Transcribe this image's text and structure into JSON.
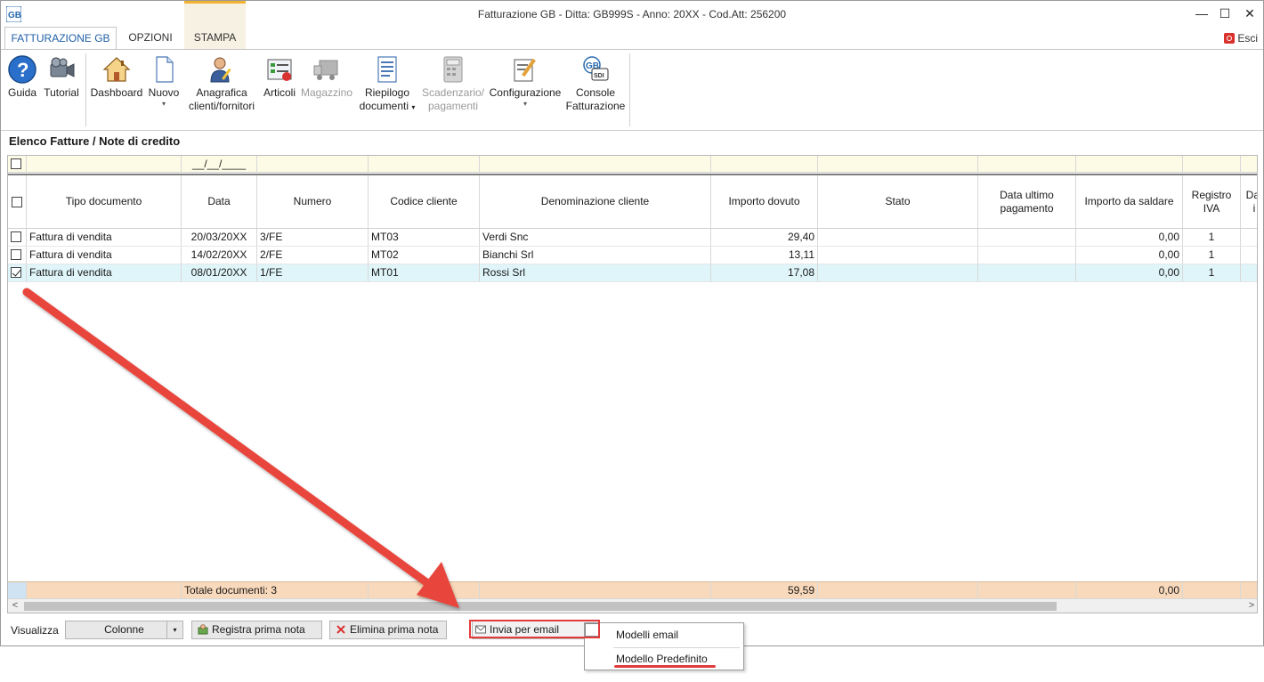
{
  "window": {
    "title": "Fatturazione GB - Ditta: GB999S - Anno: 20XX - Cod.Att: 256200",
    "min_glyph": "—",
    "max_glyph": "☐",
    "close_glyph": "✕",
    "exit_label": "Esci"
  },
  "tabs": [
    {
      "label": "FATTURAZIONE GB"
    },
    {
      "label": "OPZIONI"
    },
    {
      "label": "STAMPA"
    }
  ],
  "ribbon": {
    "guida": "Guida",
    "tutorial": "Tutorial",
    "dashboard": "Dashboard",
    "nuovo": "Nuovo",
    "anagrafica_1": "Anagrafica",
    "anagrafica_2": "clienti/fornitori",
    "articoli": "Articoli",
    "magazzino": "Magazzino",
    "riepilogo_1": "Riepilogo",
    "riepilogo_2": "documenti",
    "scadenzario_1": "Scadenzario/",
    "scadenzario_2": "pagamenti",
    "configurazione": "Configurazione",
    "console_1": "Console",
    "console_2": "Fatturazione",
    "caret": "▾"
  },
  "section_title": "Elenco Fatture / Note di credito",
  "grid": {
    "filter_date_mask": "__/__/____",
    "columns": [
      "Tipo documento",
      "Data",
      "Numero",
      "Codice cliente",
      "Denominazione cliente",
      "Importo dovuto",
      "Stato",
      "Data ultimo pagamento",
      "Importo da saldare",
      "Registro IVA",
      "Dat i"
    ],
    "rows": [
      {
        "checked": false,
        "tipo": "Fattura di vendita",
        "data": "20/03/20XX",
        "numero": "3/FE",
        "codice": "MT03",
        "denominazione": "Verdi Snc",
        "importo": "29,40",
        "stato": "",
        "data_pag": "",
        "saldare": "0,00",
        "registro": "1"
      },
      {
        "checked": false,
        "tipo": "Fattura di vendita",
        "data": "14/02/20XX",
        "numero": "2/FE",
        "codice": "MT02",
        "denominazione": "Bianchi Srl",
        "importo": "13,11",
        "stato": "",
        "data_pag": "",
        "saldare": "0,00",
        "registro": "1"
      },
      {
        "checked": true,
        "tipo": "Fattura di vendita",
        "data": "08/01/20XX",
        "numero": "1/FE",
        "codice": "MT01",
        "denominazione": "Rossi Srl",
        "importo": "17,08",
        "stato": "",
        "data_pag": "",
        "saldare": "0,00",
        "registro": "1"
      }
    ],
    "totals": {
      "label": "Totale documenti: 3",
      "importo": "59,59",
      "saldare": "0,00"
    },
    "scroll_left": "<",
    "scroll_right": ">"
  },
  "bottombar": {
    "visualizza": "Visualizza",
    "colonne": "Colonne",
    "registra": "Registra prima nota",
    "elimina": "Elimina prima nota",
    "invia": "Invia per email"
  },
  "menu": {
    "items": [
      "Modelli email",
      "Modello Predefinito"
    ]
  },
  "colors": {
    "accent_blue": "#1f5fa7",
    "annotation_red": "#e23b3b",
    "selected_row": "#dff5f9",
    "total_row": "#f9d9bb",
    "filter_row": "#fdfbe5"
  }
}
